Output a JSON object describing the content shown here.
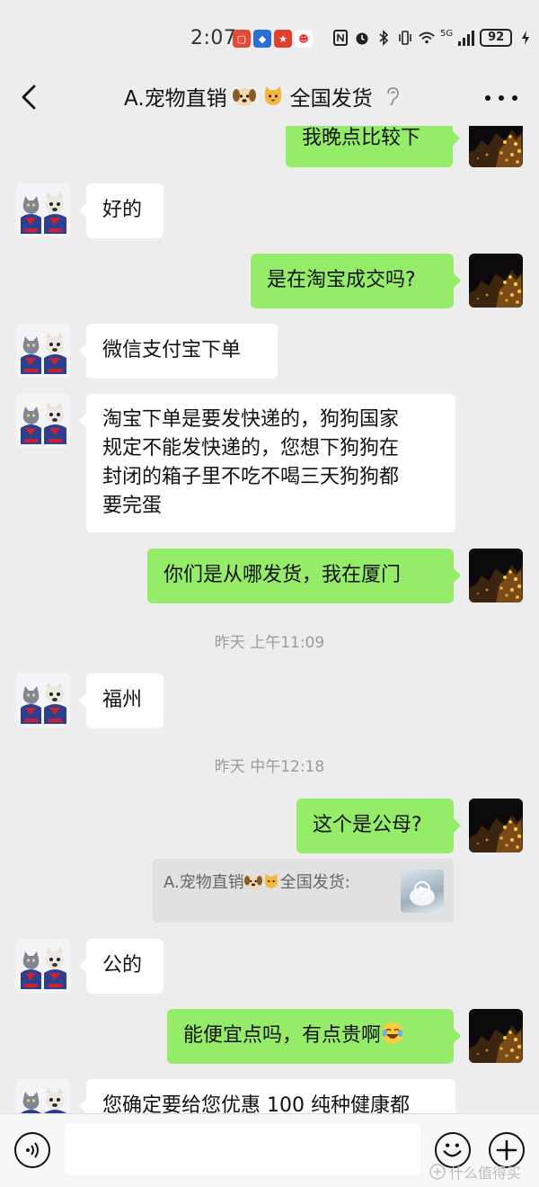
{
  "status_bar": {
    "time": "2:07",
    "battery": "92",
    "network": "5G"
  },
  "header": {
    "title_prefix": "A.宠物直销",
    "title_suffix": "全国发货",
    "title_icons": [
      "dog-emoji",
      "cat-emoji"
    ]
  },
  "messages": [
    {
      "side": "right",
      "text": "我晚点比较下"
    },
    {
      "side": "left",
      "text": "好的"
    },
    {
      "side": "right",
      "text": "是在淘宝成交吗?"
    },
    {
      "side": "left",
      "text": "微信支付宝下单"
    },
    {
      "side": "left",
      "lines": [
        "淘宝下单是要发快递的，狗狗国家",
        "规定不能发快递的，您想下狗狗在",
        "封闭的箱子里不吃不喝三天狗狗都",
        "要完蛋"
      ]
    },
    {
      "side": "right",
      "text": "你们是从哪发货，我在厦门"
    },
    {
      "type": "timestamp",
      "text": "昨天 上午11:09"
    },
    {
      "side": "left",
      "text": "福州"
    },
    {
      "type": "timestamp",
      "text": "昨天 中午12:18"
    },
    {
      "side": "right",
      "text": "这个是公母?"
    },
    {
      "type": "quote",
      "prefix": "A.宠物直销",
      "suffix": "全国发货:"
    },
    {
      "side": "left",
      "text": "公的"
    },
    {
      "side": "right",
      "text": "能便宜点吗，有点贵啊",
      "emoji": "laugh-cry-emoji"
    },
    {
      "side": "left",
      "text": "您确定要给您优惠 100 纯种健康都"
    }
  ],
  "input": {
    "placeholder": ""
  },
  "watermark": "什么值得买",
  "colors": {
    "background": "#ededed",
    "bubble_self": "#95ec69",
    "bubble_other": "#ffffff",
    "timestamp": "#9b9b9b"
  }
}
